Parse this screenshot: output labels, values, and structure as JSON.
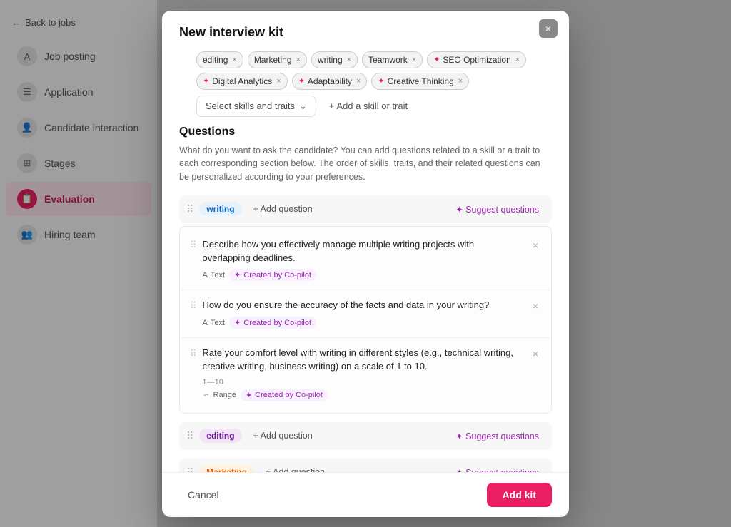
{
  "sidebar": {
    "back_label": "Back to jobs",
    "items": [
      {
        "id": "job-posting",
        "label": "Job posting",
        "icon": "A",
        "active": false
      },
      {
        "id": "application",
        "label": "Application",
        "icon": "☰",
        "active": false
      },
      {
        "id": "candidate-interaction",
        "label": "Candidate interaction",
        "icon": "👤",
        "active": false
      },
      {
        "id": "stages",
        "label": "Stages",
        "icon": "⊞",
        "active": false
      },
      {
        "id": "evaluation",
        "label": "Evaluation",
        "icon": "📋",
        "active": true
      },
      {
        "id": "hiring-team",
        "label": "Hiring team",
        "icon": "👥",
        "active": false
      }
    ]
  },
  "modal": {
    "title": "New interview kit",
    "close_label": "×",
    "tags": [
      {
        "id": "editing",
        "label": "editing",
        "type": "plain"
      },
      {
        "id": "marketing",
        "label": "Marketing",
        "type": "plain"
      },
      {
        "id": "writing",
        "label": "writing",
        "type": "plain"
      },
      {
        "id": "teamwork",
        "label": "Teamwork",
        "type": "plain"
      },
      {
        "id": "seo",
        "label": "SEO Optimization",
        "type": "ai"
      },
      {
        "id": "digital-analytics",
        "label": "Digital Analytics",
        "type": "ai"
      },
      {
        "id": "adaptability",
        "label": "Adaptability",
        "type": "ai"
      },
      {
        "id": "creative-thinking",
        "label": "Creative Thinking",
        "type": "ai"
      }
    ],
    "select_placeholder": "Select skills and traits",
    "add_skill_label": "+ Add a skill or trait",
    "questions_heading": "Questions",
    "questions_desc": "What do you want to ask the candidate? You can add questions related to a skill or a trait to each corresponding section below. The order of skills, traits, and their related questions can be personalized according to your preferences.",
    "skill_sections": [
      {
        "id": "writing",
        "label": "writing",
        "badge_class": "writing",
        "add_question_label": "+ Add question",
        "suggest_label": "✦ Suggest questions",
        "questions": [
          {
            "id": "q1",
            "text": "Describe how you effectively manage multiple writing projects with overlapping deadlines.",
            "type": "Text",
            "type_icon": "A",
            "copilot": true,
            "copilot_label": "Created by Co-pilot",
            "range_label": null
          },
          {
            "id": "q2",
            "text": "How do you ensure the accuracy of the facts and data in your writing?",
            "type": "Text",
            "type_icon": "A",
            "copilot": true,
            "copilot_label": "Created by Co-pilot",
            "range_label": null
          },
          {
            "id": "q3",
            "text": "Rate your comfort level with writing in different styles (e.g., technical writing, creative writing, business writing) on a scale of 1 to 10.",
            "type": "Range",
            "type_icon": "⇔",
            "copilot": true,
            "copilot_label": "Created by Co-pilot",
            "range_label": "1—10"
          }
        ]
      },
      {
        "id": "editing",
        "label": "editing",
        "badge_class": "editing",
        "add_question_label": "+ Add question",
        "suggest_label": "✦ Suggest questions",
        "questions": []
      },
      {
        "id": "marketing",
        "label": "Marketing",
        "badge_class": "marketing",
        "add_question_label": "+ Add question",
        "suggest_label": "✦ Suggest questions",
        "questions": []
      }
    ],
    "cancel_label": "Cancel",
    "add_kit_label": "Add kit"
  }
}
